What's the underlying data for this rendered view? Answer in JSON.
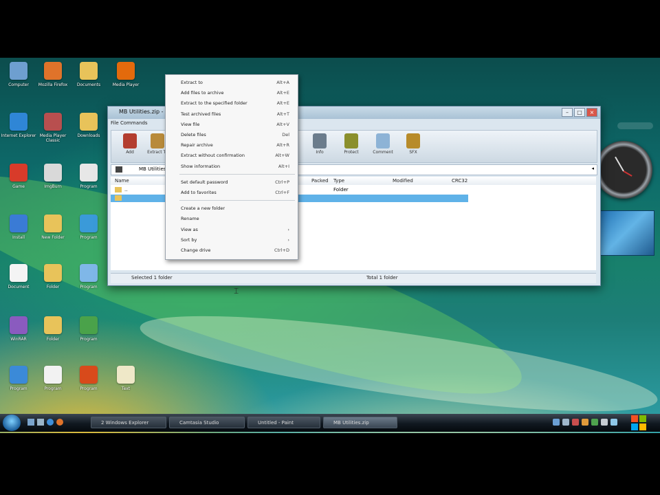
{
  "desktop": {
    "icons": [
      {
        "name": "computer",
        "label": "Computer",
        "color": "#6e9fd0"
      },
      {
        "name": "firefox",
        "label": "Mozilla Firefox",
        "color": "#e0732a"
      },
      {
        "name": "folder-1",
        "label": "Documents",
        "color": "#e8c35a"
      },
      {
        "name": "player",
        "label": "Media Player",
        "color": "#e36a0c"
      },
      {
        "name": "ie",
        "label": "Internet Explorer",
        "color": "#2f86d6"
      },
      {
        "name": "media",
        "label": "Media Player Classic",
        "color": "#b84f4f"
      },
      {
        "name": "folder-2",
        "label": "Downloads",
        "color": "#e8c35a"
      },
      {
        "name": "skype",
        "label": "Skype",
        "color": "#21a6e2"
      },
      {
        "name": "app-red",
        "label": "Program",
        "color": "#c23030"
      },
      {
        "name": "mario",
        "label": "Game",
        "color": "#d83b2a"
      },
      {
        "name": "imgburn",
        "label": "ImgBurn",
        "color": "#d9d9d9"
      },
      {
        "name": "ball",
        "label": "Program",
        "color": "#e7e7e7"
      },
      {
        "name": "flag",
        "label": "Install",
        "color": "#3a7bd5"
      },
      {
        "name": "folder-3",
        "label": "New Folder",
        "color": "#e8c35a"
      },
      {
        "name": "globe",
        "label": "Program",
        "color": "#3a9ad9"
      },
      {
        "name": "doc",
        "label": "Document",
        "color": "#f4f4f4"
      },
      {
        "name": "folder-4",
        "label": "Folder",
        "color": "#e8c35a"
      },
      {
        "name": "cd",
        "label": "Program",
        "color": "#7fb7e8"
      },
      {
        "name": "winrar",
        "label": "WinRAR",
        "color": "#8a5bbf"
      },
      {
        "name": "folder-5",
        "label": "Folder",
        "color": "#e8c35a"
      },
      {
        "name": "tool",
        "label": "Program",
        "color": "#4aa24a"
      },
      {
        "name": "chrome",
        "label": "Program",
        "color": "#3b8ad8"
      },
      {
        "name": "gmail",
        "label": "Program",
        "color": "#f2f2f2"
      },
      {
        "name": "circle-app",
        "label": "Program",
        "color": "#d84a1b"
      },
      {
        "name": "text-file",
        "label": "Text",
        "color": "#efe8c8"
      }
    ]
  },
  "window": {
    "title": "MB Utilities.zip - WinRAR",
    "menu": "File   Commands",
    "tools": [
      {
        "icon": "add-icon",
        "label": "Add",
        "color": "#b33d2f"
      },
      {
        "icon": "extract-icon",
        "label": "Extract To",
        "color": "#b88a3a"
      },
      {
        "icon": "info-icon",
        "label": "Info",
        "color": "#6b7c8c"
      },
      {
        "icon": "protect-icon",
        "label": "Protect",
        "color": "#8a8f2c"
      },
      {
        "icon": "comment-icon",
        "label": "Comment",
        "color": "#8db3d6"
      },
      {
        "icon": "sfx-icon",
        "label": "SFX",
        "color": "#b78b2a"
      }
    ],
    "address": "MB Utilities",
    "columns": [
      "Name",
      "Packed",
      "Type",
      "Modified",
      "CRC32"
    ],
    "rows": [
      {
        "name": "..",
        "type": "Folder"
      },
      {
        "name": "",
        "type": ""
      }
    ],
    "status_left": "Selected 1 folder",
    "status_right": "Total 1 folder"
  },
  "context_menu": {
    "items": [
      {
        "label": "Extract to",
        "shortcut": "Alt+A"
      },
      {
        "label": "Add files to archive",
        "shortcut": "Alt+E"
      },
      {
        "label": "Extract to the specified folder",
        "shortcut": "Alt+E"
      },
      {
        "label": "Test archived files",
        "shortcut": "Alt+T"
      },
      {
        "label": "View file",
        "shortcut": "Alt+V"
      },
      {
        "label": "Delete files",
        "shortcut": "Del"
      },
      {
        "label": "Repair archive",
        "shortcut": "Alt+R"
      },
      {
        "label": "Extract without confirmation",
        "shortcut": "Alt+W"
      },
      {
        "label": "Show information",
        "shortcut": "Alt+I"
      },
      {
        "sep": true
      },
      {
        "label": "Set default password",
        "shortcut": "Ctrl+P"
      },
      {
        "label": "Add to favorites",
        "shortcut": "Ctrl+F"
      },
      {
        "sep": true
      },
      {
        "label": "Create a new folder",
        "shortcut": ""
      },
      {
        "label": "Rename",
        "shortcut": ""
      },
      {
        "label": "View as",
        "shortcut": "›"
      },
      {
        "label": "Sort by",
        "shortcut": "›"
      },
      {
        "label": "Change drive",
        "shortcut": "Ctrl+D"
      }
    ]
  },
  "taskbar": {
    "buttons": [
      "2 Windows Explorer",
      "Camtasia Studio",
      "Untitled - Paint",
      "MB Utilities.zip"
    ]
  }
}
